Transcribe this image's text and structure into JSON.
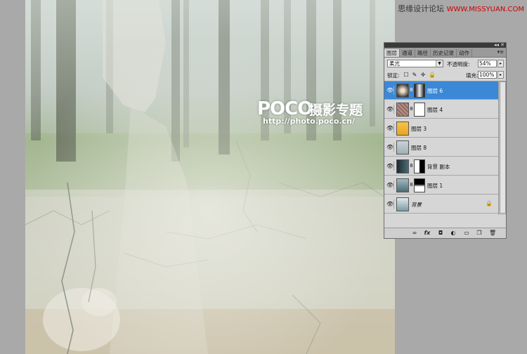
{
  "site_credit": {
    "name": "思缘设计论坛",
    "url": "WWW.MISSYUAN.COM"
  },
  "watermark": {
    "logo": "POCO",
    "title": "摄影专题",
    "url": "http://photo.poco.cn/"
  },
  "panel": {
    "collapse_icon": "◂◂",
    "close_icon": "✕",
    "menu_icon": "▾≡",
    "tabs": [
      "图层",
      "通道",
      "路径",
      "历史记录",
      "动作"
    ],
    "blend_mode": "柔光",
    "opacity_label": "不透明度:",
    "opacity_value": "54%",
    "lock_label": "锁定:",
    "fill_label": "填充:",
    "fill_value": "100%",
    "layers": [
      {
        "name": "图层 6",
        "selected": true,
        "has_mask": true
      },
      {
        "name": "图层 4",
        "selected": false,
        "has_mask": true
      },
      {
        "name": "图层 3",
        "selected": false,
        "has_mask": false
      },
      {
        "name": "图层 8",
        "selected": false,
        "has_mask": false
      },
      {
        "name": "背景 副本",
        "selected": false,
        "has_mask": true
      },
      {
        "name": "图层 1",
        "selected": false,
        "has_mask": true
      },
      {
        "name": "背景",
        "selected": false,
        "has_mask": false,
        "locked": true
      }
    ],
    "bottom_icons": [
      "link-layers",
      "fx",
      "add-mask",
      "adjustment",
      "new-group",
      "new-layer",
      "delete"
    ]
  },
  "colors": {
    "selection": "#3b88d6",
    "panel_bg": "#d6d6d6",
    "workspace_bg": "#a9a9a9"
  }
}
